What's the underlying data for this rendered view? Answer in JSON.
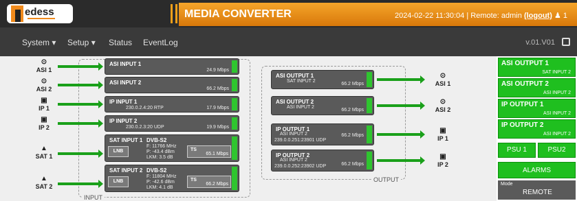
{
  "header": {
    "logo_text": "edess",
    "title": "MEDIA CONVERTER",
    "datetime": "2024-02-22 11:30:04",
    "separator": "|",
    "remote_label": "Remote:",
    "user": "admin",
    "logout": "(logout)",
    "user_count": "1"
  },
  "nav": {
    "items": [
      "System ▾",
      "Setup ▾",
      "Status",
      "EventLog"
    ],
    "version": "v.01.V01"
  },
  "input_group": {
    "label": "INPUT",
    "ports": [
      "ASI 1",
      "ASI 2",
      "IP 1",
      "IP 2",
      "SAT 1",
      "SAT 2"
    ],
    "cards": [
      {
        "title": "ASI INPUT 1",
        "detail": "",
        "rate": "24.9 Mbps"
      },
      {
        "title": "ASI INPUT 2",
        "detail": "",
        "rate": "66.2 Mbps"
      },
      {
        "title": "IP INPUT 1",
        "detail": "230.0.2.4:20 RTP",
        "rate": "17.9 Mbps"
      },
      {
        "title": "IP INPUT 2",
        "detail": "230.0.2.3:20 UDP",
        "rate": "19.9 Mbps"
      }
    ],
    "sat_cards": [
      {
        "title": "SAT INPUT 1",
        "lnb": "LNB",
        "std": "DVB-S2",
        "freq": "F: 11766 MHz",
        "power": "P: -43.4 dBm",
        "lkm": "LKM: 3.5 dB",
        "ts": "TS",
        "rate": "65.1 Mbps"
      },
      {
        "title": "SAT INPUT 2",
        "lnb": "LNB",
        "std": "DVB-S2",
        "freq": "F: 11804 MHz",
        "power": "P: -42.6 dBm",
        "lkm": "LKM: 4.1 dB",
        "ts": "TS",
        "rate": "66.2 Mbps"
      }
    ]
  },
  "output_group": {
    "label": "OUTPUT",
    "ports": [
      "ASI 1",
      "ASI 2",
      "IP 1",
      "IP 2"
    ],
    "cards": [
      {
        "title": "ASI OUTPUT 1",
        "src": "SAT INPUT 2",
        "addr": "",
        "rate": "66.2 Mbps"
      },
      {
        "title": "ASI OUTPUT 2",
        "src": "ASI INPUT 2",
        "addr": "",
        "rate": "66.2 Mbps"
      },
      {
        "title": "IP OUTPUT 1",
        "src": "ASI INPUT 2",
        "addr": "239.0.0.251:23901 UDP",
        "rate": "66.2 Mbps"
      },
      {
        "title": "IP OUTPUT 2",
        "src": "ASI INPUT 2",
        "addr": "239.0.0.252:23902 UDP",
        "rate": "66.2 Mbps"
      }
    ]
  },
  "side_panel": {
    "outputs": [
      {
        "title": "ASI OUTPUT 1",
        "src": "SAT INPUT 2"
      },
      {
        "title": "ASI OUTPUT 2",
        "src": "ASI INPUT 2"
      },
      {
        "title": "IP OUTPUT 1",
        "src": "ASI INPUT 2"
      },
      {
        "title": "IP OUTPUT 2",
        "src": "ASI INPUT 2"
      }
    ],
    "psu1": "PSU 1",
    "psu2": "PSU2",
    "alarms": "ALARMS",
    "mode_label": "Mode",
    "mode_value": "REMOTE"
  },
  "colors": {
    "accent": "#f5a52a",
    "ok": "#1fbf1f",
    "card": "#5a5a5a"
  }
}
